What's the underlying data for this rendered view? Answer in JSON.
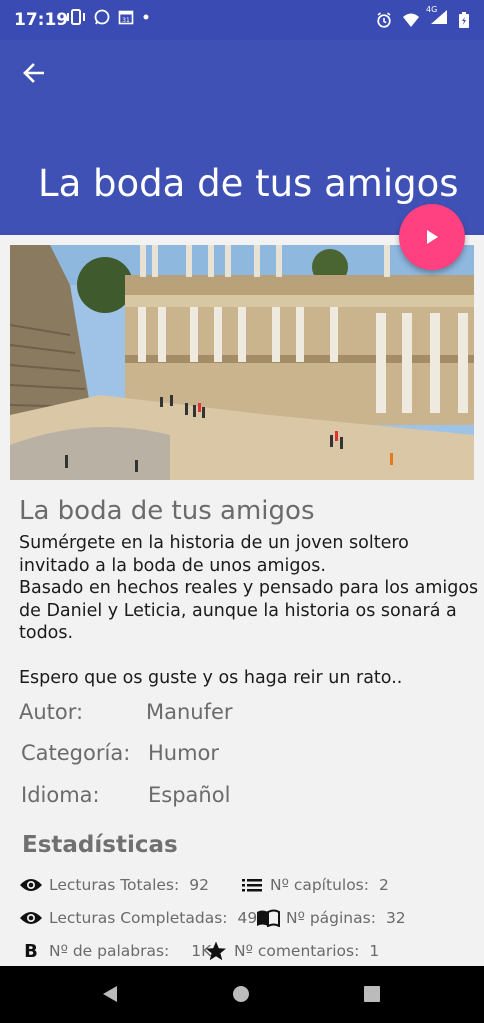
{
  "status_bar": {
    "time": "17:19",
    "network_label": "4G"
  },
  "toolbar": {
    "title": "La boda de tus amigos",
    "back_icon": "arrow-back-icon",
    "fab_icon": "play-icon",
    "primary_color": "#3f51b5",
    "accent_color": "#ff4081"
  },
  "story": {
    "title": "La boda de tus amigos",
    "description": "Sumérgete en la historia de un joven soltero invitado a la boda de unos amigos.\nBasado en hechos reales y pensado para los amigos de Daniel y Leticia, aunque la historia os sonará a todos.\n\nEspero que os guste y os haga reir un rato..",
    "author_label": "Autor:",
    "author_value": "Manufer",
    "category_label": "Categoría:",
    "category_value": "Humor",
    "language_label": "Idioma:",
    "language_value": "Español"
  },
  "stats": {
    "heading": "Estadísticas",
    "total_reads_label": "Lecturas Totales:",
    "total_reads_value": "92",
    "chapters_label": "Nº capítulos:",
    "chapters_value": "2",
    "completed_reads_label": "Lecturas Completadas:",
    "completed_reads_value": "49",
    "pages_label": "Nº páginas:",
    "pages_value": "32",
    "words_label": "Nº de palabras:",
    "words_value": "1K",
    "comments_label": "Nº comentarios:",
    "comments_value": "1"
  }
}
